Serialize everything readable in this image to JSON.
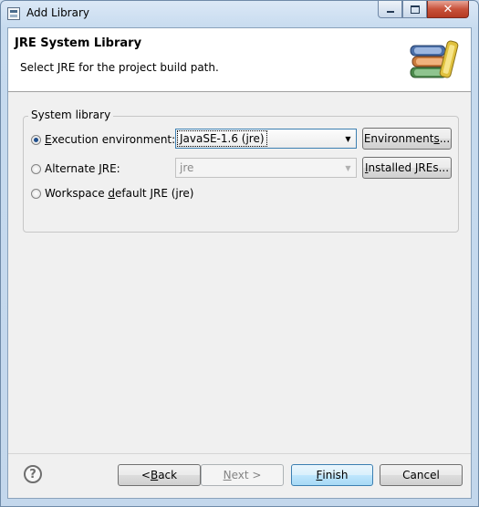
{
  "window": {
    "title": "Add Library",
    "icon": "eclipse-dialog-icon",
    "controls": {
      "minimize": "minimize-icon",
      "maximize": "maximize-icon",
      "close": "close-icon"
    }
  },
  "header": {
    "title": "JRE System Library",
    "message": "Select JRE for the project build path.",
    "image": "library-books-icon"
  },
  "group": {
    "legend": "System library",
    "options": [
      {
        "pre": "",
        "mnemonic": "E",
        "post": "xecution environment:",
        "selected": true
      },
      {
        "pre": "Alternate ",
        "mnemonic": "J",
        "post": "RE:",
        "selected": false
      },
      {
        "pre": "Workspace ",
        "mnemonic": "d",
        "post": "efault JRE (jre)",
        "selected": false
      }
    ],
    "execution_env_value": "JavaSE-1.6 (jre)",
    "alternate_jre_value": "jre",
    "environments_button": {
      "pre": "Environment",
      "mnemonic": "s",
      "post": "..."
    },
    "installed_jres_button": {
      "pre": "",
      "mnemonic": "I",
      "post": "nstalled JREs..."
    }
  },
  "footer": {
    "help_icon": "help-icon",
    "back": {
      "pre": "< ",
      "mnemonic": "B",
      "post": "ack"
    },
    "next": {
      "pre": "",
      "mnemonic": "N",
      "post": "ext >",
      "disabled": true
    },
    "finish": {
      "pre": "",
      "mnemonic": "F",
      "post": "inish"
    },
    "cancel": "Cancel"
  },
  "colors": {
    "default_button_border": "#3c7fb1",
    "close_button": "#c8523a"
  }
}
